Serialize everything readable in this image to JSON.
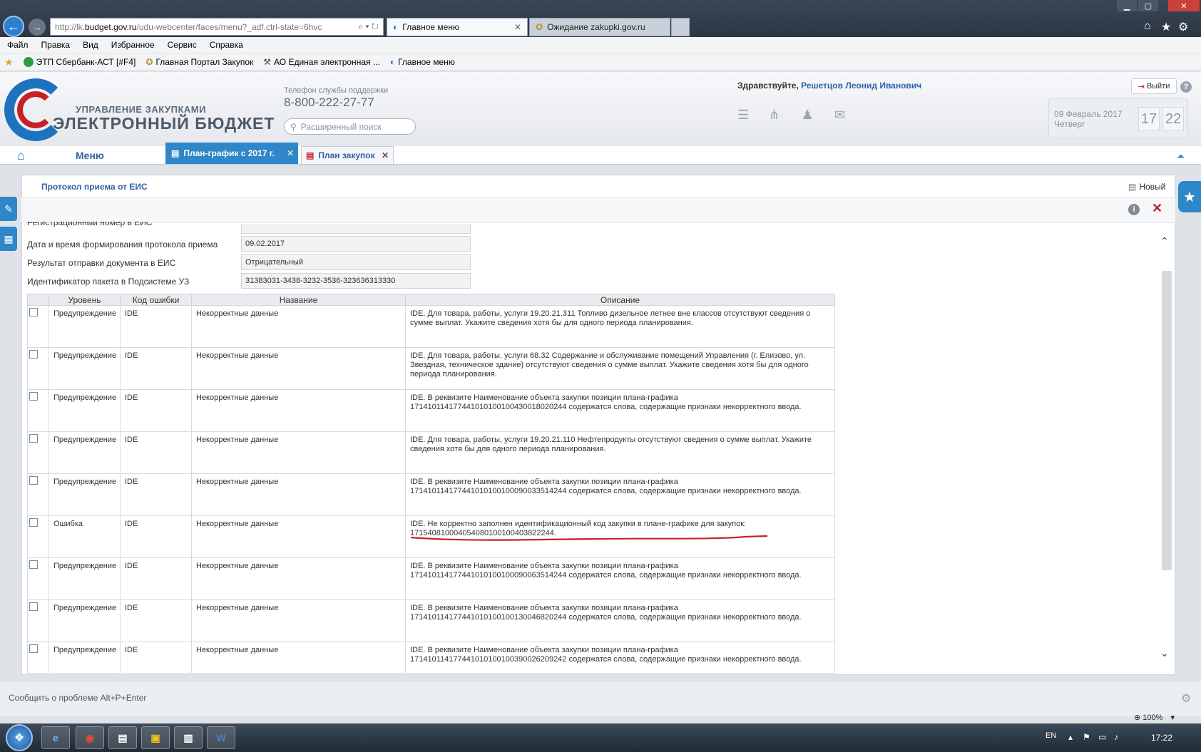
{
  "browser": {
    "address_prefix": "http://lk.",
    "address_domain": "budget.gov.ru",
    "address_rest": "/udu-webcenter/faces/menu?_adf.ctrl-state=6hvc",
    "tabs": [
      "Главное меню",
      "Ожидание zakupki.gov.ru"
    ]
  },
  "menubar": [
    "Файл",
    "Правка",
    "Вид",
    "Избранное",
    "Сервис",
    "Справка"
  ],
  "favorites": [
    "ЭТП Сбербанк-АСТ [#F4]",
    "Главная Портал Закупок",
    "АО Единая электронная ...",
    "Главное меню"
  ],
  "header": {
    "logo_line1": "УПРАВЛЕНИЕ ЗАКУПКАМИ",
    "logo_line2": "ЭЛЕКТРОННЫЙ БЮДЖЕТ",
    "support_label": "Телефон службы поддержки",
    "support_phone": "8-800-222-27-77",
    "search_placeholder": "Расширенный поиск",
    "greeting": "Здравствуйте, ",
    "user": "Решетцов Леонид Иванович",
    "exit": "Выйти",
    "help": "?",
    "date": "09 Февраль 2017",
    "weekday": "Четверг",
    "hour": "17",
    "minute": "22"
  },
  "app_tabs": {
    "menu": "Меню",
    "tab1": "План-график с 2017 г.",
    "tab2": "План закупок"
  },
  "panel": {
    "title": "Протокол приема от ЕИС",
    "new_btn": "Новый",
    "info": "i",
    "cut_label": "Регистрационный номер в ЕИС",
    "fields": [
      {
        "label": "Дата и время формирования протокола приема",
        "value": "09.02.2017"
      },
      {
        "label": "Результат отправки документа в ЕИС",
        "value": "Отрицательный"
      },
      {
        "label": "Идентификатор пакета в Подсистеме УЗ",
        "value": "31383031-3438-3232-3536-323636313330"
      }
    ]
  },
  "table": {
    "headers": [
      "Уровень",
      "Код ошибки",
      "Название",
      "Описание"
    ],
    "rows": [
      {
        "level": "Предупреждение",
        "code": "IDE",
        "name": "Некорректные данные",
        "desc": "IDE. Для товара, работы, услуги 19.20.21.311 Топливо дизельное летнее вне классов отсутствуют сведения о сумме выплат. Укажите сведения хотя бы для одного периода планирования."
      },
      {
        "level": "Предупреждение",
        "code": "IDE",
        "name": "Некорректные данные",
        "desc": "IDE. Для товара, работы, услуги 68.32 Содержание и обслуживание помещений Управления (г. Елизово, ул. Звездная, техническое здание) отсутствуют сведения о сумме выплат. Укажите сведения хотя бы для одного периода планирования."
      },
      {
        "level": "Предупреждение",
        "code": "IDE",
        "name": "Некорректные данные",
        "desc": "IDE. В реквизите Наименование объекта закупки позиции плана-графика 171410114177441010100100430018020244 содержатся слова, содержащие признаки некорректного ввода."
      },
      {
        "level": "Предупреждение",
        "code": "IDE",
        "name": "Некорректные данные",
        "desc": "IDE. Для товара, работы, услуги 19.20.21.110 Нефтепродукты отсутствуют сведения о сумме выплат. Укажите сведения хотя бы для одного периода планирования."
      },
      {
        "level": "Предупреждение",
        "code": "IDE",
        "name": "Некорректные данные",
        "desc": "IDE. В реквизите Наименование объекта закупки позиции плана-графика 171410114177441010100100090033514244 содержатся слова, содержащие признаки некорректного ввода."
      },
      {
        "level": "Ошибка",
        "code": "IDE",
        "name": "Некорректные данные",
        "desc": "IDE. Не корректно заполнен идентификационный код закупки в плане-графике для закупок: 171540810004054080100100403822244."
      },
      {
        "level": "Предупреждение",
        "code": "IDE",
        "name": "Некорректные данные",
        "desc": "IDE. В реквизите Наименование объекта закупки позиции плана-графика 171410114177441010100100090063514244 содержатся слова, содержащие признаки некорректного ввода."
      },
      {
        "level": "Предупреждение",
        "code": "IDE",
        "name": "Некорректные данные",
        "desc": "IDE. В реквизите Наименование объекта закупки позиции плана-графика 171410114177441010100100130046820244 содержатся слова, содержащие признаки некорректного ввода."
      },
      {
        "level": "Предупреждение",
        "code": "IDE",
        "name": "Некорректные данные",
        "desc": "IDE. В реквизите Наименование объекта закупки позиции плана-графика 171410114177441010100100390026209242 содержатся слова, содержащие признаки некорректного ввода."
      }
    ]
  },
  "status": {
    "report": "Сообщить о проблеме Alt+P+Enter",
    "zoom": "100%"
  },
  "taskbar": {
    "lang": "EN",
    "time": "17:22"
  },
  "colors": {
    "accent": "#2f86c8",
    "link": "#3264a0",
    "annotation": "#c8202a"
  }
}
